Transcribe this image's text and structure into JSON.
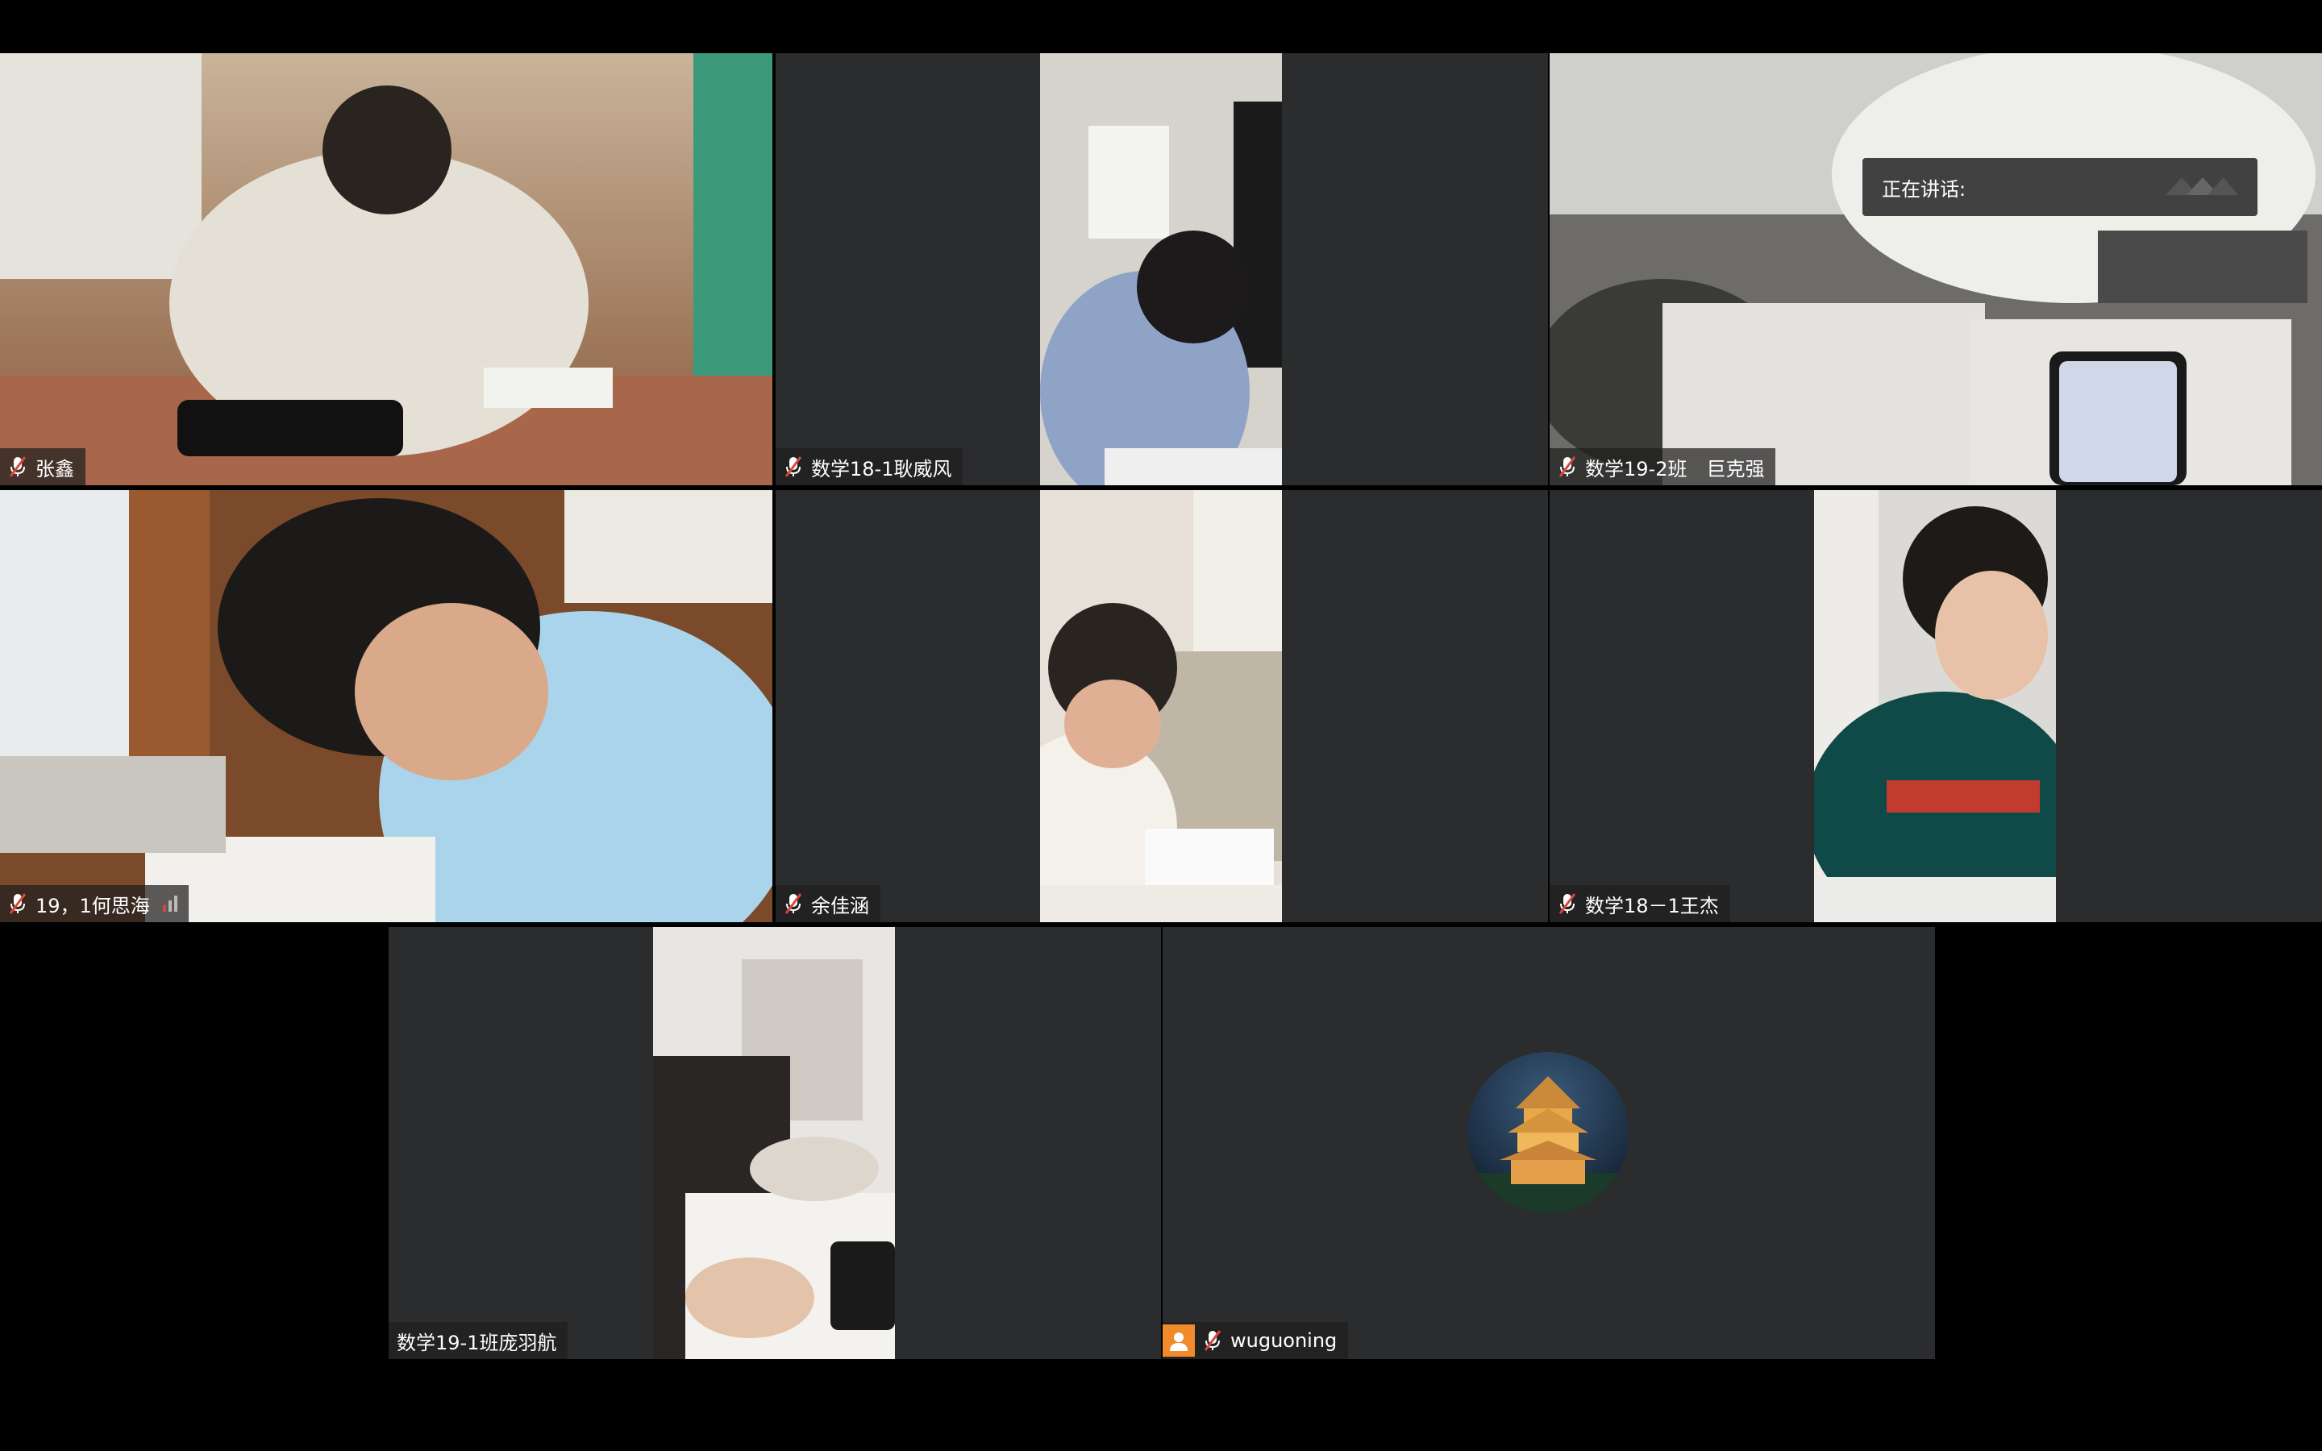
{
  "speaking_label": "正在讲话:",
  "participants": [
    {
      "name": "张鑫"
    },
    {
      "name": "数学18-1耿威风"
    },
    {
      "name": "数学19-2班　巨克强"
    },
    {
      "name": "19，1何思海"
    },
    {
      "name": "余佳涵"
    },
    {
      "name": "数学18－1王杰"
    },
    {
      "name": "数学19-1班庞羽航"
    },
    {
      "name": "wuguoning"
    }
  ],
  "colors": {
    "tile_bg": "#2b2c2e",
    "mute_red": "#d9463b",
    "avatar_orange": "#f08a2a"
  }
}
